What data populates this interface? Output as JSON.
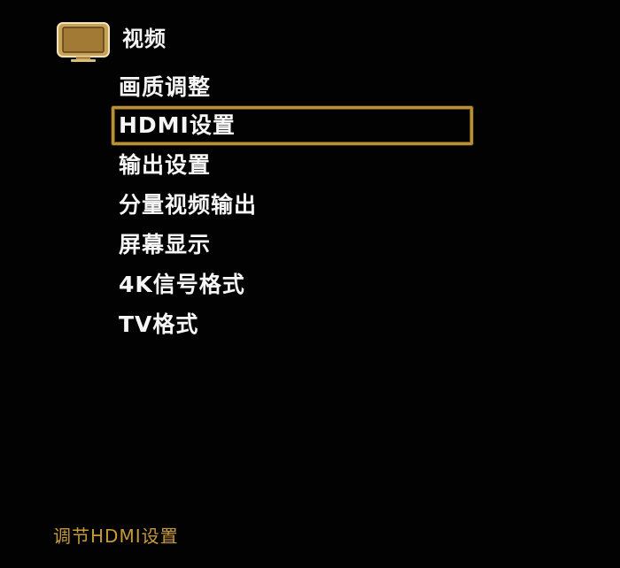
{
  "header": {
    "title": "视频",
    "icon": "tv-icon"
  },
  "menu": {
    "items": [
      {
        "label": "画质调整",
        "selected": false
      },
      {
        "label": "HDMI设置",
        "selected": true
      },
      {
        "label": "输出设置",
        "selected": false
      },
      {
        "label": "分量视频输出",
        "selected": false
      },
      {
        "label": "屏幕显示",
        "selected": false
      },
      {
        "label": "4K信号格式",
        "selected": false
      },
      {
        "label": "TV格式",
        "selected": false
      }
    ]
  },
  "status": {
    "hint": "调节HDMI设置"
  },
  "colors": {
    "background": "#000000",
    "text": "#ffffff",
    "accent": "#b8903a",
    "hint": "#c79a3c"
  }
}
